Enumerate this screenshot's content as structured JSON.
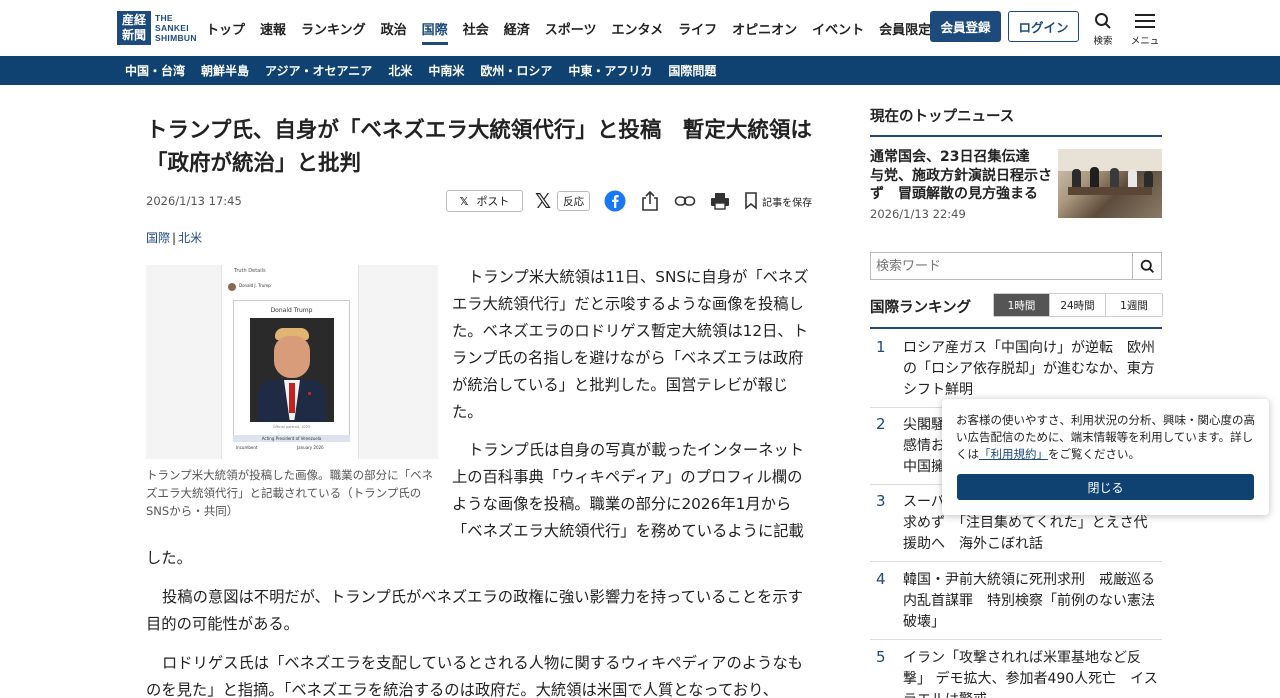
{
  "header": {
    "logo": {
      "mark": "産経新聞",
      "text_line1": "THE",
      "text_line2": "SANKEI",
      "text_line3": "SHIMBUN"
    },
    "nav": [
      "トップ",
      "速報",
      "ランキング",
      "政治",
      "国際",
      "社会",
      "経済",
      "スポーツ",
      "エンタメ",
      "ライフ",
      "オピニオン",
      "イベント",
      "会員限定記事"
    ],
    "nav_active": "国際",
    "register_label": "会員登録",
    "login_label": "ログイン",
    "search_label": "検索",
    "menu_label": "メニュ",
    "brand_color": "#1d4a7c"
  },
  "subnav": [
    "中国・台湾",
    "朝鮮半島",
    "アジア・オセアニア",
    "北米",
    "中南米",
    "欧州・ロシア",
    "中東・アフリカ",
    "国際問題"
  ],
  "article": {
    "headline": "トランプ氏、自身が「ベネズエラ大統領代行」と投稿　暫定大統領は「政府が統治」と批判",
    "date": "2026/1/13 17:45",
    "share": {
      "post": "ポスト",
      "reaction": "反応",
      "save": "記事を保存"
    },
    "category_main": "国際",
    "category_sub": "北米",
    "photo": {
      "page_title": "Truth Details",
      "account": "Donald J. Trump",
      "name": "Donald Trump",
      "portrait_label": "Official portrait, 2025",
      "role": "Acting President of Venezuela",
      "incumbent_label": "Incumbent",
      "incumbent_value": "January 2026"
    },
    "caption": "トランプ米大統領が投稿した画像。職業の部分に「ベネズエラ大統領代行」と記載されている（トランプ氏のSNSから・共同）",
    "p1": "トランプ米大統領は11日、SNSに自身が「ベネズエラ大統領代行」だと示唆するような画像を投稿した。ベネズエラのロドリゲス暫定大統領は12日、トランプ氏の名指しを避けながら「ベネズエラは政府が統治している」と批判した。国営テレビが報じた。",
    "p2": "トランプ氏は自身の写真が載ったインターネット上の百科事典「ウィキペディア」のプロフィル欄のような画像を投稿。職業の部分に2026年1月から「ベネズエラ大統領代行」を務めているように記載した。",
    "p3": "投稿の意図は不明だが、トランプ氏がベネズエラの政権に強い影響力を持っていることを示す目的の可能性がある。",
    "p4": "ロドリゲス氏は「ベネズエラを支配しているとされる人物に関するウィキペディアのようなものを見た」と指摘。「ベネズエラを統治するのは政府だ。大統領は米国で人質となっており、"
  },
  "sidebar": {
    "top_title": "現在のトップニュース",
    "top_news": {
      "title": "通常国会、23日召集伝達　与党、施政方針演説日程示さず　冒頭解散の見方強まる",
      "date": "2026/1/13 22:49"
    },
    "search_placeholder": "検索ワード",
    "ranking_title": "国際ランキング",
    "ranking_tabs": [
      "1時間",
      "24時間",
      "1週間"
    ],
    "ranking_active": "1時間",
    "ranking": [
      {
        "num": "1",
        "text": "ロシア産ガス「中国向け」が逆転　欧州の「ロシア依存脱却」が進むなか、東方シフト鮮明"
      },
      {
        "num": "2",
        "text": "尖閣騒\n感情お\n中国擁"
      },
      {
        "num": "3",
        "text": "スーパ\n求めず　「注目集めてくれた」とえさ代援助へ　海外こぼれ話"
      },
      {
        "num": "4",
        "text": "韓国・尹前大統領に死刑求刑　戒厳巡る内乱首謀罪　特別検察「前例のない憲法破壊」"
      },
      {
        "num": "5",
        "text": "イラン「攻撃されれば米軍基地など反撃」 デモ拡大、参加者490人死亡　イスラエルは警戒"
      }
    ]
  },
  "cookie": {
    "text_before": "お客様の使いやすさ、利用状況の分析、興味・関心度の高い広告配信のために、端末情報等を利用しています。詳しくは",
    "link": "「利用規約」",
    "text_after": "をご覧ください。",
    "close": "閉じる"
  }
}
